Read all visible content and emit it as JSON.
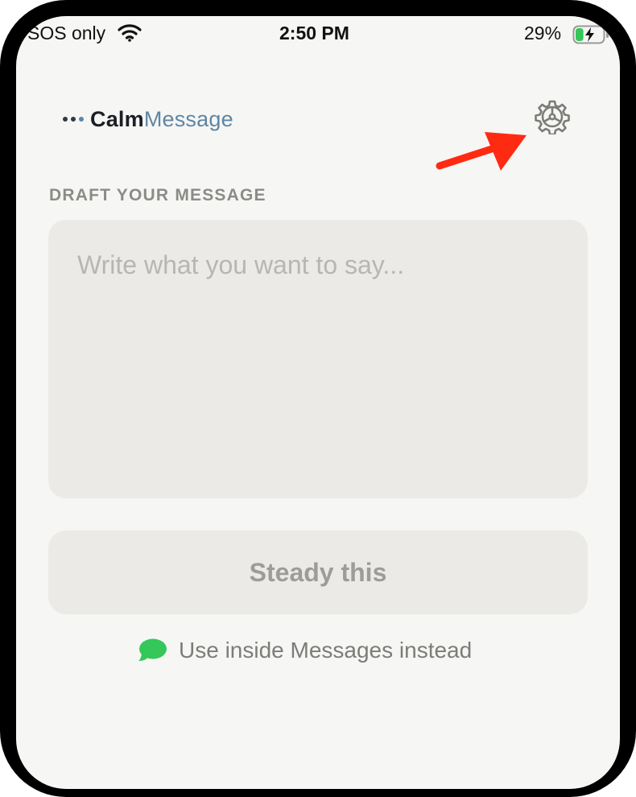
{
  "status_bar": {
    "carrier": "SOS only",
    "time": "2:50 PM",
    "battery_percent": "29%",
    "battery_level": 0.29,
    "charging": true,
    "wifi_icon": "wifi-icon"
  },
  "header": {
    "logo_part1": "Calm",
    "logo_part2": "Message",
    "settings_icon": "gear-icon"
  },
  "draft": {
    "section_label": "DRAFT YOUR MESSAGE",
    "placeholder": "Write what you want to say...",
    "value": ""
  },
  "actions": {
    "steady_label": "Steady this",
    "messages_link_label": "Use inside Messages instead",
    "messages_icon": "speech-bubble-icon"
  },
  "colors": {
    "accent": "#5f86a3",
    "background": "#f6f6f4",
    "card": "#ebeae7",
    "messages_green": "#34c759",
    "annotation_arrow": "#ff2a12"
  }
}
